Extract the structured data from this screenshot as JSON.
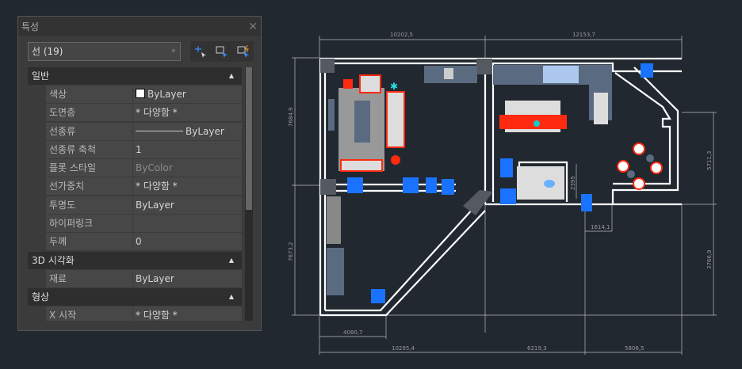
{
  "panel": {
    "title": "특성",
    "selection": "선 (19)",
    "sections": [
      {
        "label": "일반",
        "rows": [
          {
            "key": "색상",
            "value": "ByLayer"
          },
          {
            "key": "도면층",
            "value": "* 다양함 *"
          },
          {
            "key": "선종류",
            "value": "ByLayer"
          },
          {
            "key": "선종류 축척",
            "value": "1"
          },
          {
            "key": "플롯 스타일",
            "value": "ByColor"
          },
          {
            "key": "선가중치",
            "value": "* 다양함 *"
          },
          {
            "key": "투명도",
            "value": "ByLayer"
          },
          {
            "key": "하이퍼링크",
            "value": ""
          },
          {
            "key": "두께",
            "value": "0"
          }
        ]
      },
      {
        "label": "3D 시각화",
        "rows": [
          {
            "key": "재료",
            "value": "ByLayer"
          }
        ]
      },
      {
        "label": "형상",
        "rows": [
          {
            "key": "X 시작",
            "value": "* 다양함 *"
          }
        ]
      }
    ]
  },
  "drawing": {
    "dimensions": {
      "top_left": "10202,5",
      "top_right": "12153,7",
      "left_top": "7684,9",
      "left_bottom": "7673,2",
      "right_top": "5711,3",
      "right_bottom": "3766,9",
      "bottom_small": "4080,7",
      "bottom_left": "10295,4",
      "bottom_mid": "6219,3",
      "bottom_right": "5806,5",
      "inner_h": "1614,1",
      "inner_v": "2395"
    },
    "colors": {
      "wall": "#ffffff",
      "furniture": "#5a6a80",
      "accent": "#ff2a10",
      "door": "#1a73ff"
    }
  }
}
